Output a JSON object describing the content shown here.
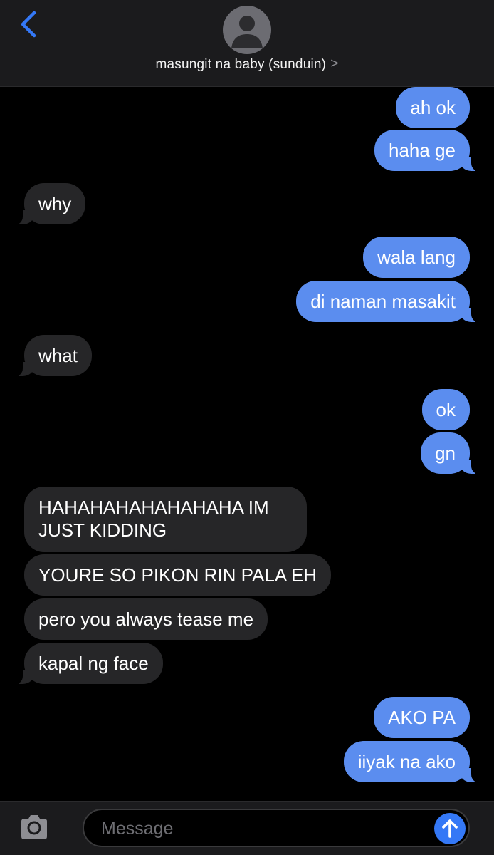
{
  "header": {
    "contact_name": "masungit na baby (sunduin)",
    "chevron": ">",
    "back_icon": "chevron-left-icon",
    "avatar_icon": "person-silhouette-icon"
  },
  "messages": [
    {
      "direction": "out",
      "text": "ah ok"
    },
    {
      "direction": "out",
      "text": "haha ge"
    },
    {
      "direction": "in",
      "text": "why"
    },
    {
      "direction": "out",
      "text": "wala lang"
    },
    {
      "direction": "out",
      "text": "di naman masakit"
    },
    {
      "direction": "in",
      "text": "what"
    },
    {
      "direction": "out",
      "text": "ok"
    },
    {
      "direction": "out",
      "text": "gn"
    },
    {
      "direction": "in",
      "text": "HAHAHAHAHAHAHAHA IM JUST KIDDING"
    },
    {
      "direction": "in",
      "text": "YOURE SO PIKON RIN PALA EH"
    },
    {
      "direction": "in",
      "text": "pero you always tease me"
    },
    {
      "direction": "in",
      "text": "kapal ng face"
    },
    {
      "direction": "out",
      "text": "AKO PA"
    },
    {
      "direction": "out",
      "text": "iiyak na ako"
    }
  ],
  "composer": {
    "placeholder": "Message",
    "camera_icon": "camera-icon",
    "send_icon": "arrow-up-icon"
  },
  "colors": {
    "outgoing_bubble": "#5b8def",
    "incoming_bubble": "#262628",
    "accent": "#3478f6",
    "background": "#000000"
  }
}
